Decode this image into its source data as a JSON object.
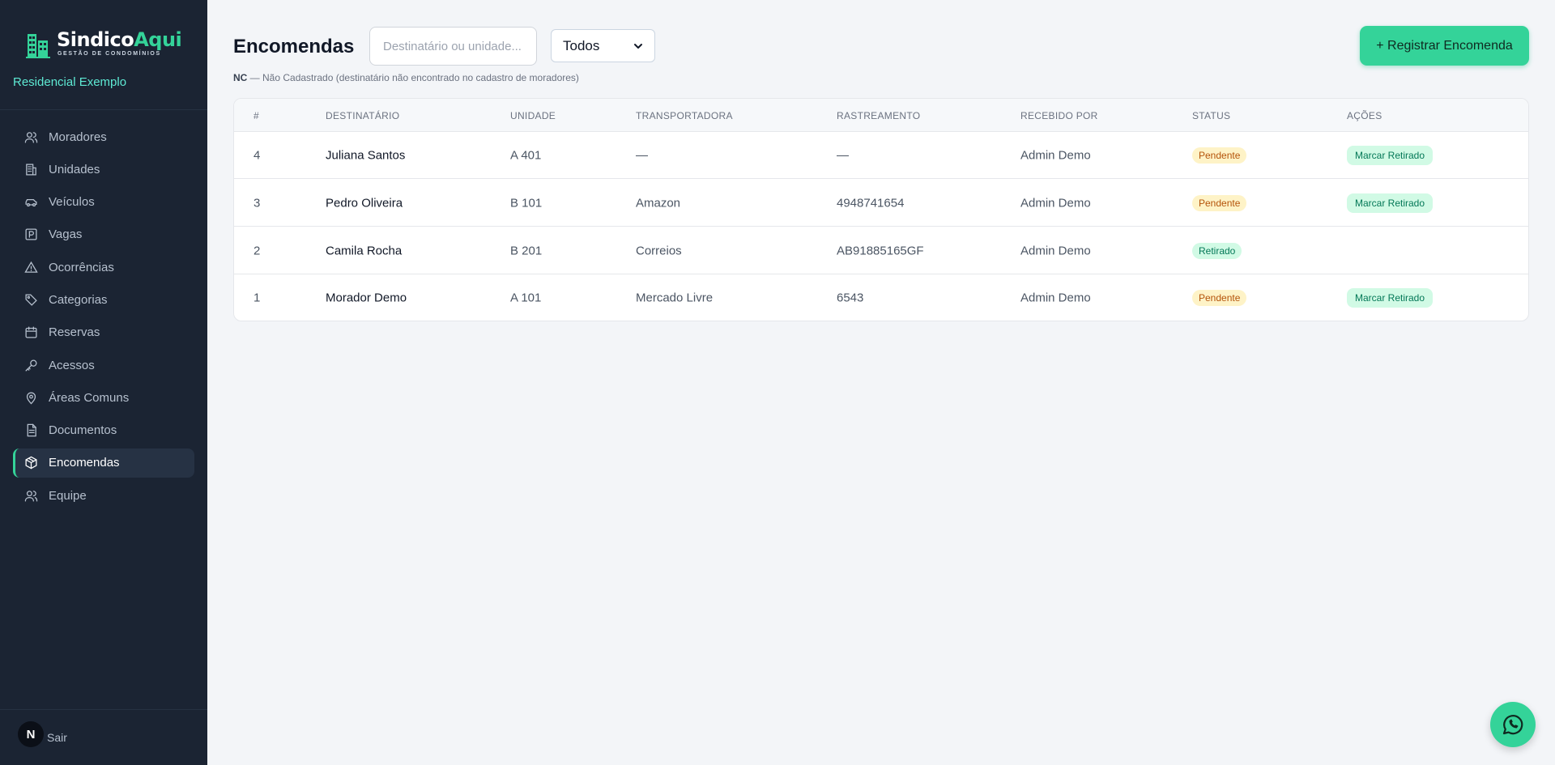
{
  "brand": {
    "name_part1": "Sindico",
    "name_part2": "Aqui",
    "tagline": "GESTÃO DE CONDOMÍNIOS",
    "accent_color": "#34d399"
  },
  "condo_name": "Residencial Exemplo",
  "sidebar": {
    "items": [
      {
        "label": "Moradores",
        "icon": "users-icon"
      },
      {
        "label": "Unidades",
        "icon": "building-icon"
      },
      {
        "label": "Veículos",
        "icon": "car-icon"
      },
      {
        "label": "Vagas",
        "icon": "parking-icon"
      },
      {
        "label": "Ocorrências",
        "icon": "warning-icon"
      },
      {
        "label": "Categorias",
        "icon": "tag-icon"
      },
      {
        "label": "Reservas",
        "icon": "calendar-icon"
      },
      {
        "label": "Acessos",
        "icon": "key-icon"
      },
      {
        "label": "Áreas Comuns",
        "icon": "map-pin-icon"
      },
      {
        "label": "Documentos",
        "icon": "document-icon"
      },
      {
        "label": "Encomendas",
        "icon": "package-icon",
        "active": true
      },
      {
        "label": "Equipe",
        "icon": "team-icon"
      }
    ],
    "user_initial": "N",
    "logout_label": "Sair"
  },
  "header": {
    "title": "Encomendas",
    "search_placeholder": "Destinatário ou unidade...",
    "filter_selected": "Todos",
    "register_label": "+ Registrar Encomenda"
  },
  "legend": {
    "abbr": "NC",
    "text": " — Não Cadastrado (destinatário não encontrado no cadastro de moradores)"
  },
  "table": {
    "headers": [
      "#",
      "DESTINATÁRIO",
      "UNIDADE",
      "TRANSPORTADORA",
      "RASTREAMENTO",
      "RECEBIDO POR",
      "STATUS",
      "AÇÕES"
    ],
    "rows": [
      {
        "id": "4",
        "recipient": "Juliana Santos",
        "unit": "A 401",
        "carrier": "—",
        "tracking": "—",
        "received_by": "Admin Demo",
        "status": "Pendente",
        "action": "Marcar Retirado"
      },
      {
        "id": "3",
        "recipient": "Pedro Oliveira",
        "unit": "B 101",
        "carrier": "Amazon",
        "tracking": "4948741654",
        "received_by": "Admin Demo",
        "status": "Pendente",
        "action": "Marcar Retirado"
      },
      {
        "id": "2",
        "recipient": "Camila Rocha",
        "unit": "B 201",
        "carrier": "Correios",
        "tracking": "AB91885165GF",
        "received_by": "Admin Demo",
        "status": "Retirado",
        "action": ""
      },
      {
        "id": "1",
        "recipient": "Morador Demo",
        "unit": "A 101",
        "carrier": "Mercado Livre",
        "tracking": "6543",
        "received_by": "Admin Demo",
        "status": "Pendente",
        "action": "Marcar Retirado"
      }
    ]
  },
  "colors": {
    "sidebar_bg": "#1b2433",
    "pending_bg": "#fef3c7",
    "pending_text": "#b45309",
    "done_bg": "#d1fae5",
    "done_text": "#047857"
  },
  "whatsapp_icon": "whatsapp-icon"
}
